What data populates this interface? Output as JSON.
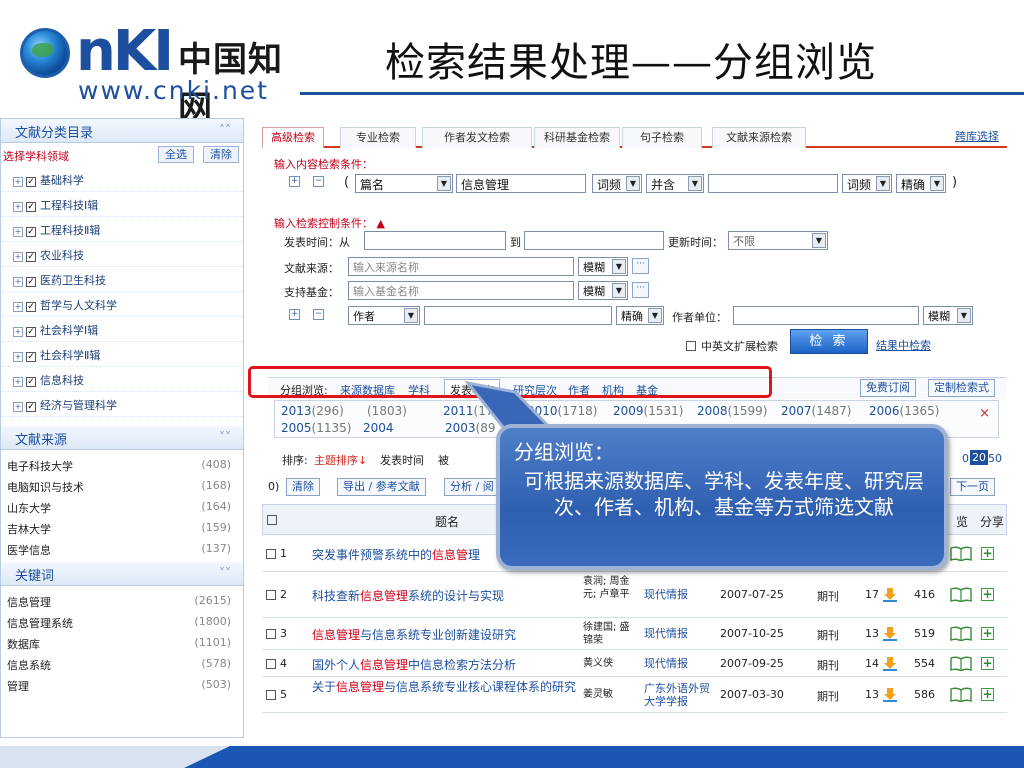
{
  "slide": {
    "logo_text": "nKI",
    "logo_cn": "中国知网",
    "logo_url": "www.cnki.net",
    "title": "检索结果处理——分组浏览"
  },
  "sidebar": {
    "catalog_title": "文献分类目录",
    "select_field_label": "选择学科领域",
    "select_all": "全选",
    "clear": "清除",
    "categories": [
      "基础科学",
      "工程科技Ⅰ辑",
      "工程科技Ⅱ辑",
      "农业科技",
      "医药卫生科技",
      "哲学与人文科学",
      "社会科学Ⅰ辑",
      "社会科学Ⅱ辑",
      "信息科技",
      "经济与管理科学"
    ],
    "source_title": "文献来源",
    "sources": [
      {
        "name": "电子科技大学",
        "count": "(408)"
      },
      {
        "name": "电脑知识与技术",
        "count": "(168)"
      },
      {
        "name": "山东大学",
        "count": "(164)"
      },
      {
        "name": "吉林大学",
        "count": "(159)"
      },
      {
        "name": "医学信息",
        "count": "(137)"
      }
    ],
    "keyword_title": "关键词",
    "keywords": [
      {
        "name": "信息管理",
        "count": "(2615)"
      },
      {
        "name": "信息管理系统",
        "count": "(1800)"
      },
      {
        "name": "数据库",
        "count": "(1101)"
      },
      {
        "name": "信息系统",
        "count": "(578)"
      },
      {
        "name": "管理",
        "count": "(503)"
      }
    ]
  },
  "tabs": {
    "items": [
      "高级检索",
      "专业检索",
      "作者发文检索",
      "科研基金检索",
      "句子检索",
      "文献来源检索"
    ],
    "cross_db": "跨库选择"
  },
  "content_cond": {
    "label": "输入内容检索条件：",
    "open_paren": "(",
    "field": "篇名",
    "value": "信息管理",
    "freq": "词频",
    "logic": "并含",
    "freq2": "词频",
    "match": "精确",
    "close_paren": ")"
  },
  "control_cond": {
    "label": "输入检索控制条件：",
    "pub_time": "发表时间：从",
    "to": "到",
    "update_time": "更新时间：",
    "update_value": "不限",
    "source_label": "文献来源：",
    "source_ph": "输入来源名称",
    "fund_label": "支持基金：",
    "fund_ph": "输入基金名称",
    "fuzzy": "模糊",
    "fuzzy2": "模糊",
    "author_field": "作者",
    "exact": "精确",
    "author_unit": "作者单位：",
    "fuzzy3": "模糊",
    "cn_en_expand": "中英文扩展检索",
    "search": "检 索",
    "in_results": "结果中检索"
  },
  "grouping": {
    "label": "分组浏览:",
    "items": [
      "来源数据库",
      "学科",
      "发表年度",
      "研究层次",
      "作者",
      "机构",
      "基金"
    ],
    "free_sub": "免费订阅",
    "custom": "定制检索式",
    "years": [
      {
        "y": "2013",
        "n": "(296)"
      },
      {
        "y": "",
        "n": "(1803)"
      },
      {
        "y": "2011",
        "n": "(1735)"
      },
      {
        "y": "2010",
        "n": "(1718)"
      },
      {
        "y": "2009",
        "n": "(1531)"
      },
      {
        "y": "2008",
        "n": "(1599)"
      },
      {
        "y": "2007",
        "n": "(1487)"
      },
      {
        "y": "2006",
        "n": "(1365)"
      },
      {
        "y": "2005",
        "n": "(1135)"
      },
      {
        "y": "2004",
        "n": ""
      },
      {
        "y": "2003",
        "n": "(89"
      }
    ],
    "close": "×"
  },
  "sort": {
    "label": "排序:",
    "topic": "主题排序",
    "pub": "发表时间",
    "cut": "被",
    "page_sizes": [
      "0",
      "20",
      "50"
    ]
  },
  "actions": {
    "count": "0)",
    "clear": "清除",
    "export": "导出 / 参考文献",
    "analysis": "分析 / 阅",
    "next": "下一页"
  },
  "table": {
    "col_title": "题名",
    "col_read": "览",
    "col_share": "分享",
    "rows": [
      {
        "no": "1",
        "pre": "突发事件预警系统中的",
        "hl": "信息管",
        "post": "理",
        "auth": "",
        "src": "",
        "date": "",
        "db": "",
        "cite": "",
        "dl": ""
      },
      {
        "no": "2",
        "pre": "科技查新",
        "hl": "信息管理",
        "post": "系统的设计与实现",
        "auth": "袁润; 周金元; 卢章平",
        "src": "现代情报",
        "date": "2007-07-25",
        "db": "期刊",
        "cite": "17",
        "dl": "416"
      },
      {
        "no": "3",
        "pre": "",
        "hl": "信息管理",
        "post": "与信息系统专业创新建设研究",
        "auth": "徐建国; 盛锦荣",
        "src": "现代情报",
        "date": "2007-10-25",
        "db": "期刊",
        "cite": "13",
        "dl": "519"
      },
      {
        "no": "4",
        "pre": "国外个人",
        "hl": "信息管理",
        "post": "中信息检索方法分析",
        "auth": "黄义侠",
        "src": "现代情报",
        "date": "2007-09-25",
        "db": "期刊",
        "cite": "14",
        "dl": "554"
      },
      {
        "no": "5",
        "pre": "关于",
        "hl": "信息管理",
        "post": "与信息系统专业核心课程体系的研究",
        "auth": "姜灵敏",
        "src": "广东外语外贸大学学报",
        "date": "2007-03-30",
        "db": "期刊",
        "cite": "13",
        "dl": "586"
      }
    ]
  },
  "callout": {
    "title": "分组浏览：",
    "body": "可根据来源数据库、学科、发表年度、研究层次、作者、机构、基金等方式筛选文献"
  },
  "colors": {
    "brand_blue": "#1d4f9e",
    "highlight_red": "#e0151b",
    "callout_bg": "#2f5fb0"
  }
}
